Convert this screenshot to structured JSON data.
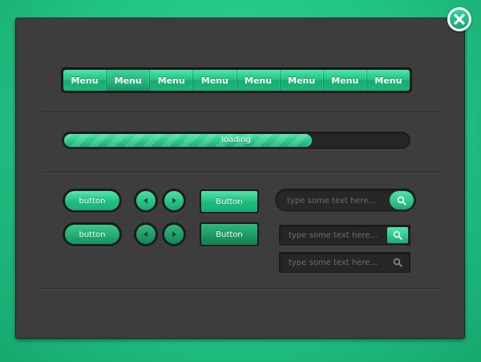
{
  "colors": {
    "accent": "#22c184",
    "panel": "#3d3d3d",
    "dark": "#1b1b1b"
  },
  "close": {
    "icon": "close-icon"
  },
  "menu": {
    "active_index": 1,
    "items": [
      {
        "label": "Menu"
      },
      {
        "label": "Menu"
      },
      {
        "label": "Menu"
      },
      {
        "label": "Menu"
      },
      {
        "label": "Menu"
      },
      {
        "label": "Menu"
      },
      {
        "label": "Menu"
      },
      {
        "label": "Menu"
      }
    ]
  },
  "progress": {
    "label": "loading",
    "percent": 72
  },
  "buttons": {
    "pill_1": "button",
    "pill_2": "button",
    "rect_1": "Button",
    "rect_2": "Button",
    "prev_icon": "triangle-left-icon",
    "next_icon": "triangle-right-icon"
  },
  "search": {
    "pill_placeholder": "type some text here...",
    "box_green_placeholder": "type some text here...",
    "box_plain_placeholder": "type some text here...",
    "icon": "magnifier-icon"
  }
}
